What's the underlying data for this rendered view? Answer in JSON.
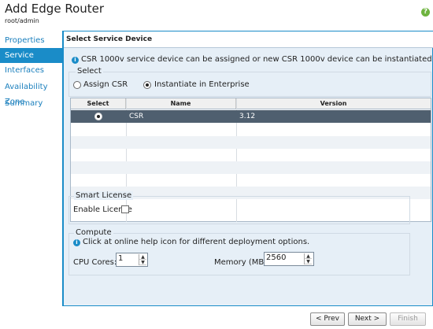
{
  "header": {
    "title": "Add Edge Router",
    "subtitle": "root/admin",
    "help_icon": "help-icon"
  },
  "nav": {
    "items": [
      {
        "label": "Properties"
      },
      {
        "label": "Service Device"
      },
      {
        "label": "Interfaces"
      },
      {
        "label": "Availability Zone"
      },
      {
        "label": "Summary"
      }
    ],
    "active": "Service Device"
  },
  "panel": {
    "title": "Select Service Device",
    "info_text": "CSR 1000v service device can be assigned or new CSR 1000v device can be instantiated",
    "select_group": {
      "legend": "Select",
      "options": [
        {
          "label": "Assign CSR",
          "checked": false
        },
        {
          "label": "Instantiate in Enterprise",
          "checked": true
        }
      ]
    },
    "table": {
      "columns": [
        "Select",
        "Name",
        "Version"
      ],
      "rows": [
        {
          "selected": true,
          "name": "CSR",
          "version": "3.12"
        }
      ]
    },
    "smart_license": {
      "legend": "Smart License",
      "enable_label": "Enable License",
      "checked": false
    },
    "compute": {
      "legend": "Compute",
      "info_text": "Click at online help icon for different deployment options.",
      "cpu_label": "CPU Cores:",
      "cpu_value": "1",
      "memory_label": "Memory (MB):",
      "memory_value": "2560"
    }
  },
  "footer": {
    "prev_label": "< Prev",
    "next_label": "Next >",
    "finish_label": "Finish"
  },
  "colors": {
    "accent": "#1a8cc8",
    "panel_bg": "#e6eff7",
    "selected_row": "#4f5f6f",
    "help": "#6eb43f"
  }
}
